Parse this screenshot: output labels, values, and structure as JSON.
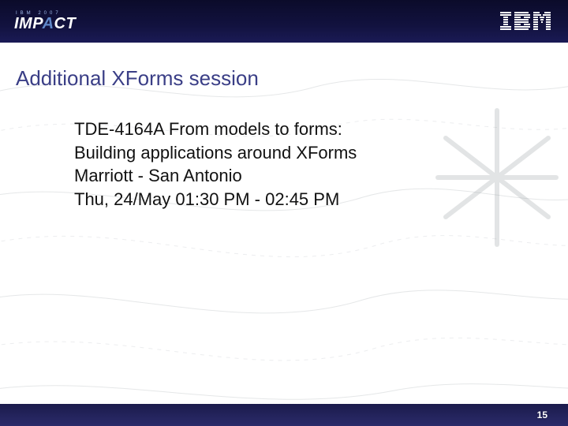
{
  "header": {
    "event_year": "IBM 2007",
    "event_name_html": "IMPACT",
    "company": "IBM"
  },
  "slide": {
    "title": "Additional XForms session",
    "body_lines": [
      "TDE-4164A From models to forms:",
      "Building applications around XForms",
      "Marriott - San Antonio",
      "Thu, 24/May 01:30 PM - 02:45 PM"
    ]
  },
  "footer": {
    "page_number": "15"
  }
}
